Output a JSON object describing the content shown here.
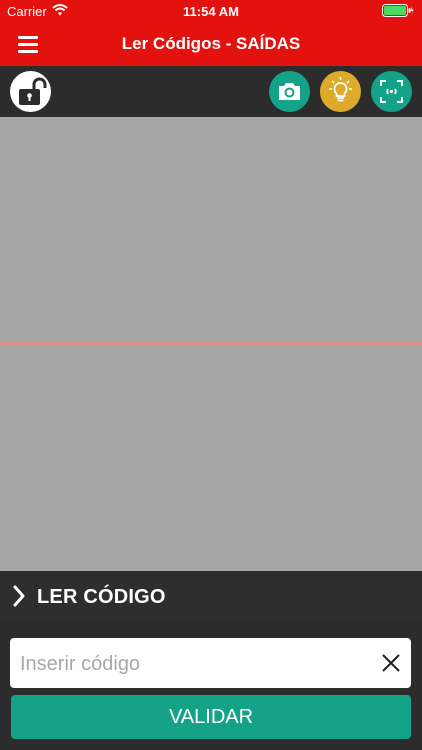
{
  "status_bar": {
    "carrier": "Carrier",
    "time": "11:54 AM"
  },
  "navbar": {
    "title": "Ler Códigos - SAÍDAS",
    "menu_icon": "hamburger-icon"
  },
  "toolbar": {
    "lock_icon": "unlocked-padlock-icon",
    "camera_icon": "camera-icon",
    "flash_icon": "lightbulb-icon",
    "focus_icon": "focus-icon"
  },
  "section": {
    "label": "LER CÓDIGO"
  },
  "code_input": {
    "placeholder": "Inserir código",
    "value": ""
  },
  "actions": {
    "validate_label": "VALIDAR"
  },
  "colors": {
    "brand_red": "#e4120f",
    "accent_teal": "#14a389",
    "accent_yellow": "#ddaa2b",
    "dark": "#2c2c2c",
    "viewfinder": "#a6a6a6"
  }
}
